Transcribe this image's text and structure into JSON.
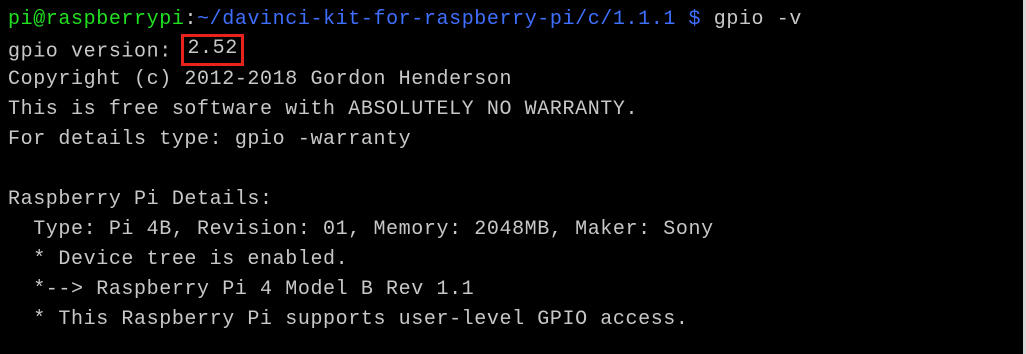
{
  "prompt": {
    "user_host": "pi@raspberrypi",
    "colon": ":",
    "path": "~/davinci-kit-for-raspberry-pi/c/1.1.1",
    "dollar": " $",
    "command": " gpio -v"
  },
  "output": {
    "version_label": "gpio version: ",
    "version_value": "2.52",
    "copyright": "Copyright (c) 2012-2018 Gordon Henderson",
    "free_software": "This is free software with ABSOLUTELY NO WARRANTY.",
    "details_hint": "For details type: gpio -warranty",
    "blank": "",
    "pi_details_header": "Raspberry Pi Details:",
    "type_line": "  Type: Pi 4B, Revision: 01, Memory: 2048MB, Maker: Sony",
    "device_tree": "  * Device tree is enabled.",
    "model_line": "  *--> Raspberry Pi 4 Model B Rev 1.1",
    "gpio_access": "  * This Raspberry Pi supports user-level GPIO access."
  },
  "colors": {
    "background": "#000000",
    "text": "#c8c8c8",
    "prompt_green": "#20e020",
    "path_blue": "#3f6fff",
    "highlight_red": "#e8231e"
  }
}
